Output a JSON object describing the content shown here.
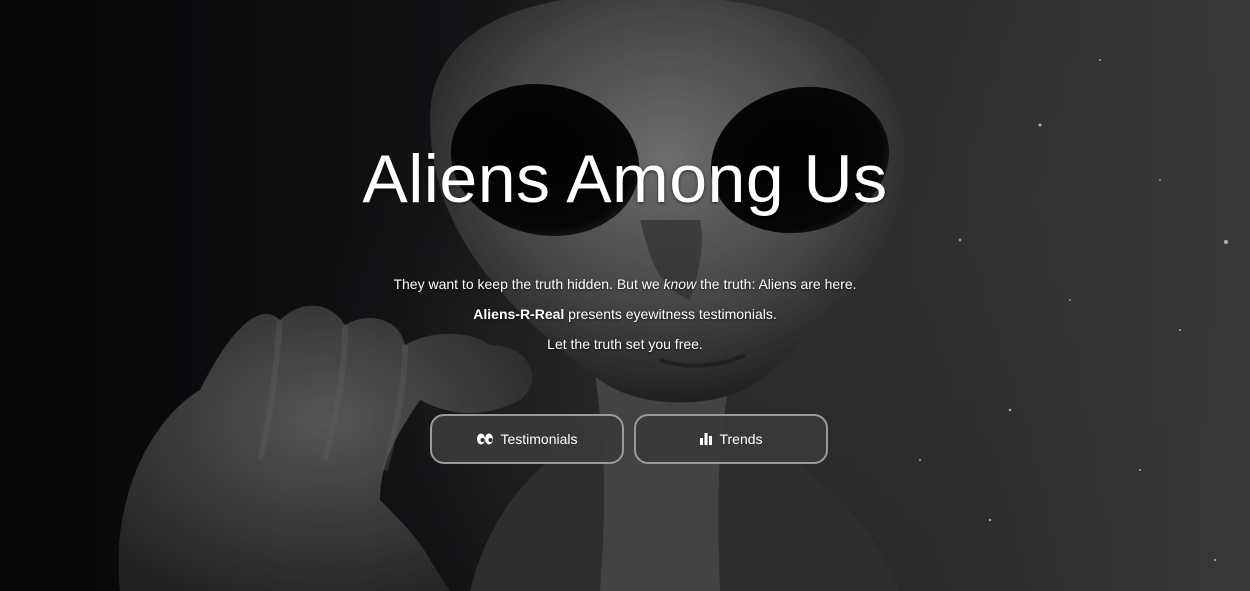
{
  "hero": {
    "title": "Aliens Among Us",
    "line1_before": "They want to keep the truth hidden. But we ",
    "line1_em": "know",
    "line1_after": " the truth: Aliens are here.",
    "line2_brand": "Aliens-R-Real",
    "line2_after": " presents eyewitness testimonials.",
    "line3": "Let the truth set you free."
  },
  "buttons": {
    "testimonials": {
      "label": "Testimonials",
      "icon": "eyes-icon"
    },
    "trends": {
      "label": "Trends",
      "icon": "bar-chart-icon"
    }
  },
  "colors": {
    "text": "#ffffff",
    "button_bg": "#3a3a3a",
    "button_border": "#9a9a9a"
  }
}
